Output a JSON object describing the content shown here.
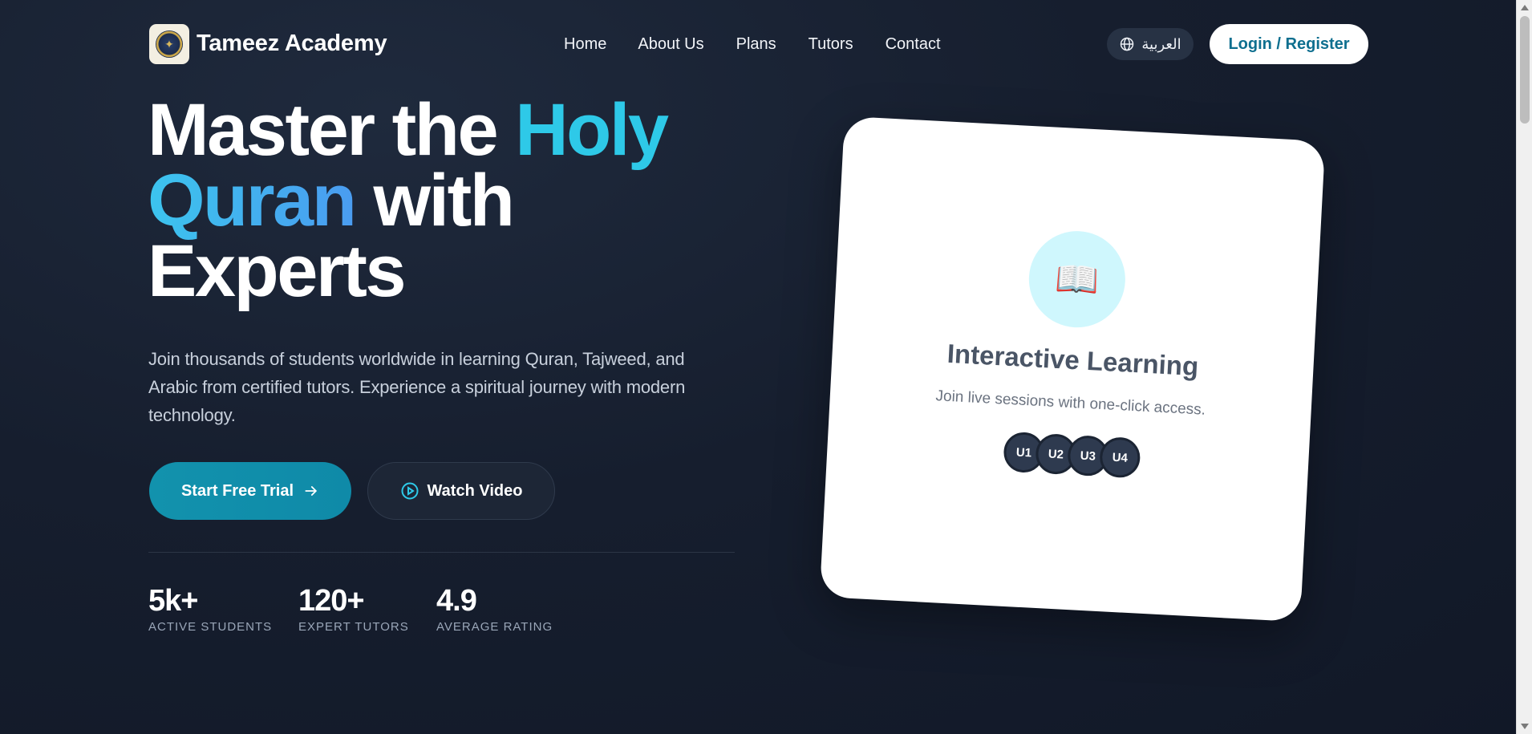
{
  "brand": {
    "name": "Tameez Academy",
    "logo_icon": "academy-seal-icon"
  },
  "nav": {
    "items": [
      "Home",
      "About Us",
      "Plans",
      "Tutors",
      "Contact"
    ]
  },
  "header": {
    "language_label": "العربية",
    "language_icon": "globe-icon",
    "login_label": "Login / Register"
  },
  "hero": {
    "title_part1": "Master the ",
    "title_accent1": "Holy",
    "title_accent2": "Quran",
    "title_part2": " with",
    "title_part3": "Experts",
    "subtitle": "Join thousands of students worldwide in learning Quran, Tajweed, and Arabic from certified tutors. Experience a spiritual journey with modern technology.",
    "cta_primary": "Start Free Trial",
    "cta_secondary": "Watch Video"
  },
  "stats": [
    {
      "value": "5k+",
      "label": "ACTIVE STUDENTS"
    },
    {
      "value": "120+",
      "label": "EXPERT TUTORS"
    },
    {
      "value": "4.9",
      "label": "AVERAGE RATING"
    }
  ],
  "card": {
    "icon": "📖",
    "title": "Interactive Learning",
    "description": "Join live sessions with one-click access.",
    "avatars": [
      "U1",
      "U2",
      "U3",
      "U4"
    ]
  },
  "colors": {
    "accent": "#2ec9e8",
    "primary_button": "#1292ad",
    "login_text": "#0e6f8f"
  }
}
